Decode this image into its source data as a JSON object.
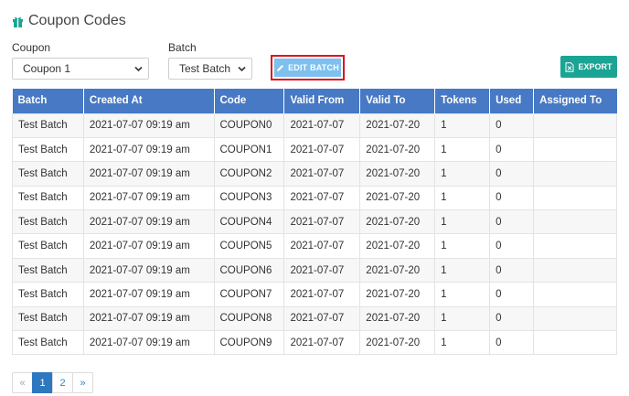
{
  "header": {
    "title": "Coupon Codes",
    "icon": "gift-icon"
  },
  "filters": {
    "coupon": {
      "label": "Coupon",
      "value": "Coupon 1"
    },
    "batch": {
      "label": "Batch",
      "value": "Test Batch"
    }
  },
  "toolbar": {
    "edit_batch_label": "EDIT BATCH",
    "export_label": "EXPORT"
  },
  "colors": {
    "header_bg": "#4779c4",
    "edit_button": "#7ec0ee",
    "export_button": "#1aa493",
    "highlight_border": "#e0141e"
  },
  "table": {
    "columns": [
      "Batch",
      "Created At",
      "Code",
      "Valid From",
      "Valid To",
      "Tokens",
      "Used",
      "Assigned To"
    ],
    "rows": [
      [
        "Test Batch",
        "2021-07-07 09:19 am",
        "COUPON0",
        "2021-07-07",
        "2021-07-20",
        "1",
        "0",
        ""
      ],
      [
        "Test Batch",
        "2021-07-07 09:19 am",
        "COUPON1",
        "2021-07-07",
        "2021-07-20",
        "1",
        "0",
        ""
      ],
      [
        "Test Batch",
        "2021-07-07 09:19 am",
        "COUPON2",
        "2021-07-07",
        "2021-07-20",
        "1",
        "0",
        ""
      ],
      [
        "Test Batch",
        "2021-07-07 09:19 am",
        "COUPON3",
        "2021-07-07",
        "2021-07-20",
        "1",
        "0",
        ""
      ],
      [
        "Test Batch",
        "2021-07-07 09:19 am",
        "COUPON4",
        "2021-07-07",
        "2021-07-20",
        "1",
        "0",
        ""
      ],
      [
        "Test Batch",
        "2021-07-07 09:19 am",
        "COUPON5",
        "2021-07-07",
        "2021-07-20",
        "1",
        "0",
        ""
      ],
      [
        "Test Batch",
        "2021-07-07 09:19 am",
        "COUPON6",
        "2021-07-07",
        "2021-07-20",
        "1",
        "0",
        ""
      ],
      [
        "Test Batch",
        "2021-07-07 09:19 am",
        "COUPON7",
        "2021-07-07",
        "2021-07-20",
        "1",
        "0",
        ""
      ],
      [
        "Test Batch",
        "2021-07-07 09:19 am",
        "COUPON8",
        "2021-07-07",
        "2021-07-20",
        "1",
        "0",
        ""
      ],
      [
        "Test Batch",
        "2021-07-07 09:19 am",
        "COUPON9",
        "2021-07-07",
        "2021-07-20",
        "1",
        "0",
        ""
      ]
    ]
  },
  "pagination": {
    "prev": "«",
    "pages": [
      "1",
      "2"
    ],
    "current": "1",
    "next": "»"
  }
}
